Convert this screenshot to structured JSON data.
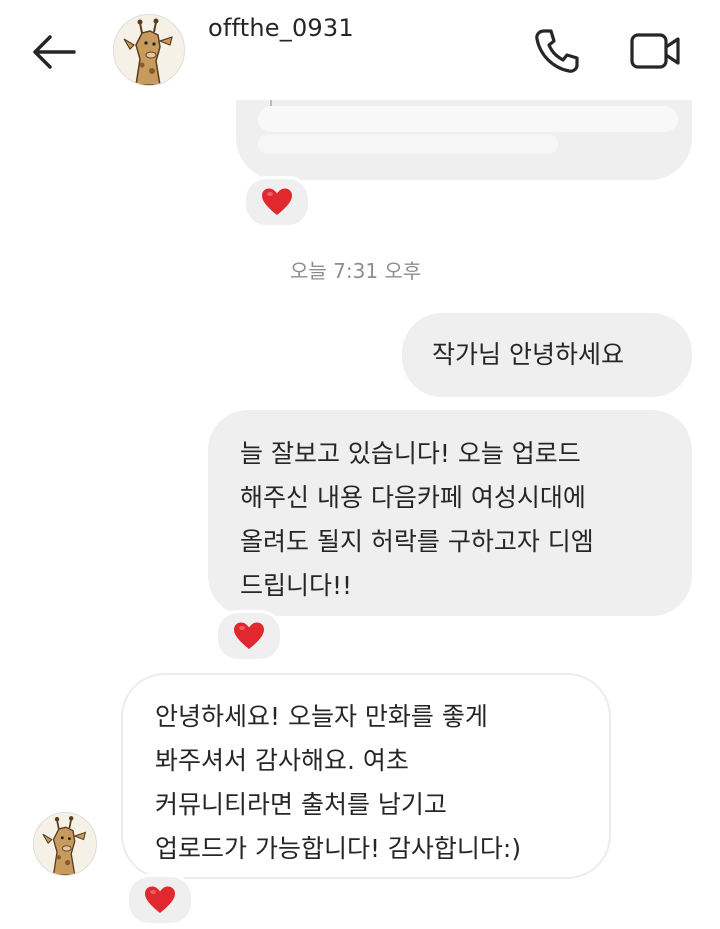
{
  "header": {
    "username": "offthe_0931",
    "icons": {
      "back": "arrow-left-icon",
      "call": "phone-icon",
      "video": "video-camera-icon"
    }
  },
  "conversation": {
    "timestamp": "오늘 7:31 오후",
    "messages": [
      {
        "from": "me",
        "lines": [
          "작가님 안녕하세요"
        ]
      },
      {
        "from": "me",
        "lines": [
          "늘 잘보고 있습니다! 오늘 업로드",
          "해주신 내용 다음카페 여성시대에",
          "올려도 될지 허락를 구하고자 디엠",
          "드립니다!!"
        ],
        "reaction": "❤"
      },
      {
        "from": "them",
        "lines": [
          "안녕하세요! 오늘자 만화를 좋게",
          "봐주셔서 감사해요. 여초",
          "커뮤니티라면 출처를 남기고",
          "업로드가 가능합니다! 감사합니다:)"
        ],
        "reaction": "❤"
      }
    ]
  },
  "colors": {
    "bubble_gray": "#efefef",
    "heart": "#e0282e",
    "text": "#262626",
    "muted": "#8e8e8e"
  }
}
